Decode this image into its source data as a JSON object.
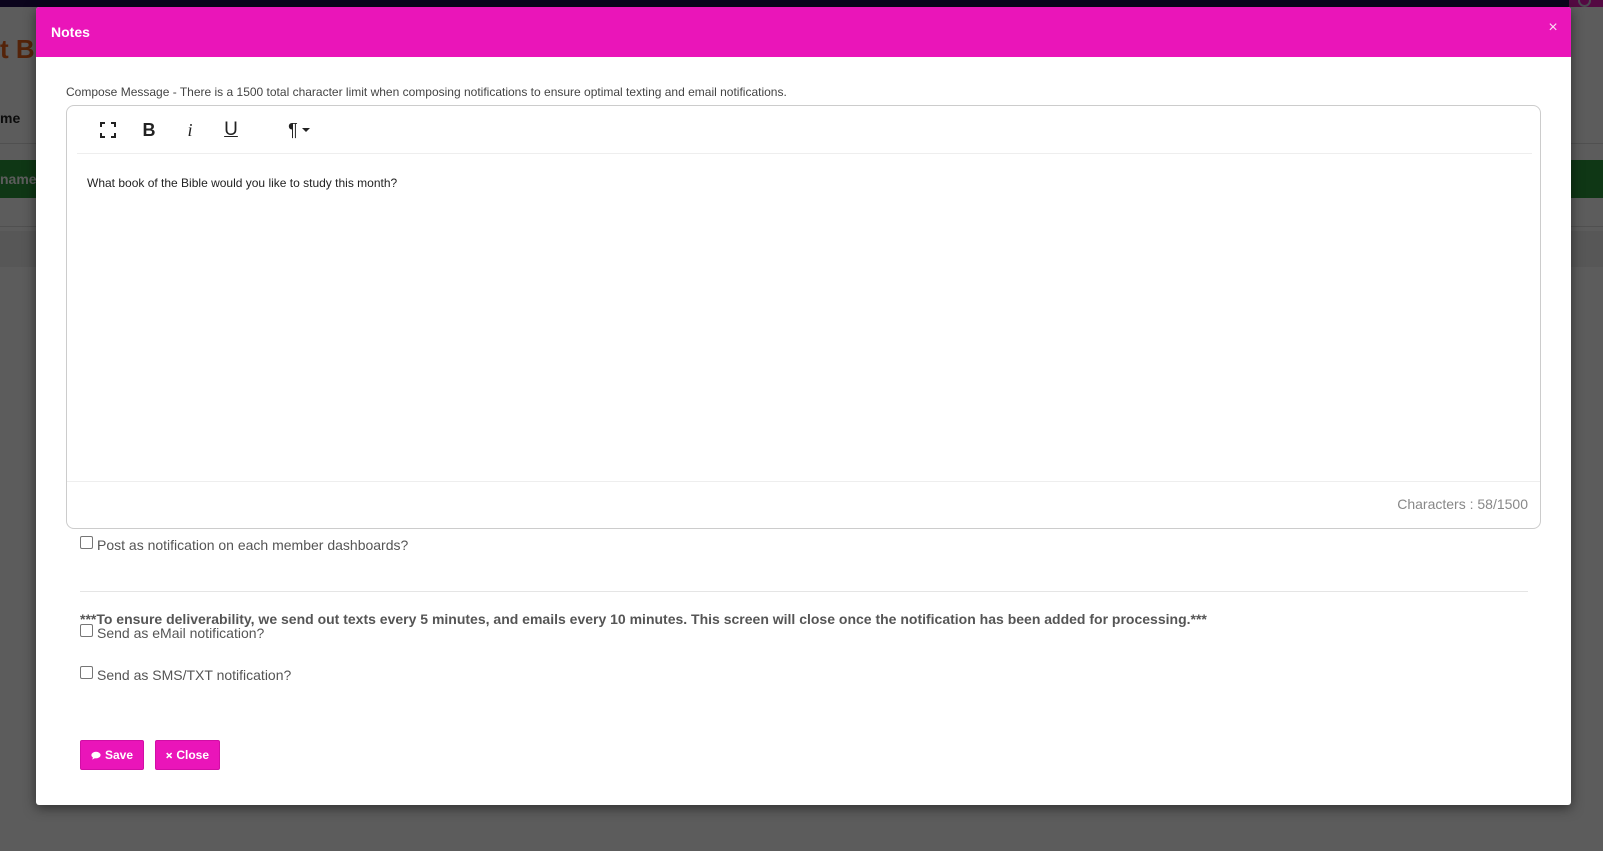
{
  "background": {
    "brand_fragment": "t B",
    "nav_fragment": "me",
    "green_bar_fragment": "nament"
  },
  "modal": {
    "title": "Notes",
    "close_glyph": "×",
    "compose_help": "Compose Message - There is a 1500 total character limit when composing notifications to ensure optimal texting and email notifications.",
    "toolbar": {
      "fullscreen_icon": "fullscreen-icon",
      "bold_label": "B",
      "italic_label": "i",
      "underline_label": "U",
      "paragraph_label": "¶"
    },
    "editor_text": "What book of the Bible would you like to study this month?",
    "char_count": "Characters : 58/1500",
    "post_dashboard_label": "Post as notification on each member dashboards?",
    "notice": "***To ensure deliverability, we send out texts every 5 minutes, and emails every 10 minutes. This screen will close once the notification has been added for processing.***",
    "email_label": "Send as eMail notification?",
    "sms_label": "Send as SMS/TXT notification?",
    "save_label": "Save",
    "close_label": "Close"
  },
  "colors": {
    "accent": "#ea15b9",
    "topbar": "#1f0d4f",
    "green_bar": "#2c9a3a",
    "brand": "#e9631a"
  }
}
